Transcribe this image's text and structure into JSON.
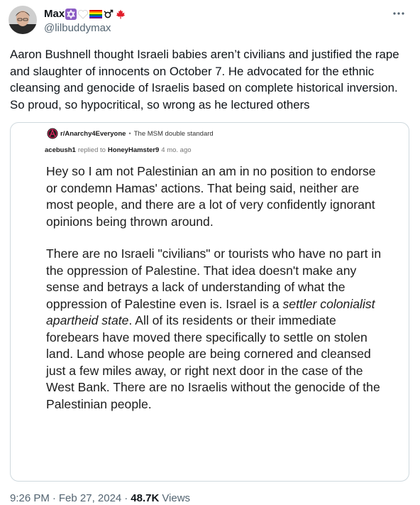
{
  "author": {
    "name": "Max",
    "handle": "@lilbuddymax",
    "flag_icons": [
      "star-of-david-icon",
      "white-heart-icon",
      "rainbow-flag-icon",
      "gender-symbol-icon",
      "maple-leaf-icon"
    ]
  },
  "tweet": {
    "text": "Aaron Bushnell thought Israeli babies aren’t civilians and justified the rape and slaughter of innocents on October 7. He advocated for the ethnic cleansing and genocide of Israelis based on complete historical inversion. So proud, so hypocritical, so wrong as he lectured others"
  },
  "embedded_post": {
    "subreddit": "r/Anarchy4Everyone",
    "separator": "•",
    "post_title": "The MSM double standard",
    "commenter": "acebush1",
    "replied_to_label": "replied to",
    "replied_to_user": "HoneyHamster9",
    "age": "4 mo. ago",
    "paragraph1": "Hey so I am not Palestinian an am in no position to endorse or condemn Hamas' actions. That being said, neither are most people, and there are a lot of very confidently ignorant opinions being thrown around.",
    "paragraph2_part1": "There are no Israeli \"civilians\" or tourists who have no part in the oppression of Palestine. That idea doesn't make any sense and betrays a lack of understanding of what the oppression of Palestine even is. Israel is a ",
    "paragraph2_italic": "settler colonialist apartheid state",
    "paragraph2_part2": ". All of its residents or their immediate forebears have moved there specifically to settle on stolen land. Land whose people are being cornered and cleansed just a few miles away, or right next door in the case of the West Bank. There are no Israelis without the genocide of the Palestinian people."
  },
  "meta": {
    "time": "9:26 PM",
    "dot": "·",
    "date": "Feb 27, 2024",
    "dot2": "·",
    "views_count": "48.7K",
    "views_label": "Views"
  },
  "colors": {
    "text": "#0f1419",
    "secondary": "#536471",
    "border": "#cfd9de"
  }
}
